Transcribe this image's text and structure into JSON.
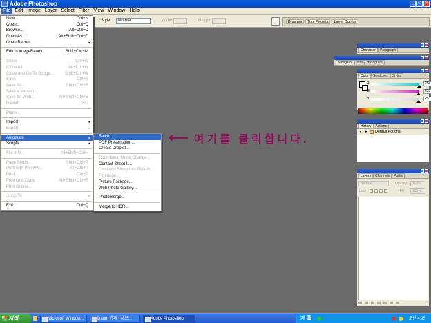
{
  "window": {
    "title": "Adobe Photoshop"
  },
  "menubar": [
    "File",
    "Edit",
    "Image",
    "Layer",
    "Select",
    "Filter",
    "View",
    "Window",
    "Help"
  ],
  "options_bar": {
    "style_label": "Style:",
    "style_value": "Normal",
    "width_label": "Width:",
    "height_label": "Height:"
  },
  "palette_well": [
    "Brushes",
    "Tool Presets",
    "Layer Comps"
  ],
  "file_menu": [
    {
      "label": "New...",
      "shortcut": "Ctrl+N",
      "enabled": true
    },
    {
      "label": "Open...",
      "shortcut": "Ctrl+O",
      "enabled": true
    },
    {
      "label": "Browse...",
      "shortcut": "Alt+Ctrl+O",
      "enabled": true
    },
    {
      "label": "Open As...",
      "shortcut": "Alt+Shift+Ctrl+O",
      "enabled": true
    },
    {
      "label": "Open Recent",
      "shortcut": "",
      "enabled": true,
      "submenu": true
    },
    {
      "separator": true
    },
    {
      "label": "Edit in ImageReady",
      "shortcut": "Shift+Ctrl+M",
      "enabled": true
    },
    {
      "separator": true
    },
    {
      "label": "Close",
      "shortcut": "Ctrl+W",
      "enabled": false
    },
    {
      "label": "Close All",
      "shortcut": "Alt+Ctrl+W",
      "enabled": false
    },
    {
      "label": "Close and Go To Bridge...",
      "shortcut": "Shift+Ctrl+W",
      "enabled": false
    },
    {
      "label": "Save",
      "shortcut": "Ctrl+S",
      "enabled": false
    },
    {
      "label": "Save As...",
      "shortcut": "Shift+Ctrl+S",
      "enabled": false
    },
    {
      "label": "Save a Version...",
      "shortcut": "",
      "enabled": false
    },
    {
      "label": "Save for Web...",
      "shortcut": "Alt+Shift+Ctrl+S",
      "enabled": false
    },
    {
      "label": "Revert",
      "shortcut": "F12",
      "enabled": false
    },
    {
      "separator": true
    },
    {
      "label": "Place...",
      "shortcut": "",
      "enabled": false
    },
    {
      "separator": true
    },
    {
      "label": "Import",
      "shortcut": "",
      "enabled": true,
      "submenu": true
    },
    {
      "label": "Export",
      "shortcut": "",
      "enabled": false,
      "submenu": true
    },
    {
      "separator": true
    },
    {
      "label": "Automate",
      "shortcut": "",
      "enabled": true,
      "submenu": true,
      "highlighted": true
    },
    {
      "label": "Scripts",
      "shortcut": "",
      "enabled": true,
      "submenu": true
    },
    {
      "separator": true
    },
    {
      "label": "File Info...",
      "shortcut": "Alt+Shift+Ctrl+I",
      "enabled": false
    },
    {
      "separator": true
    },
    {
      "label": "Page Setup...",
      "shortcut": "Shift+Ctrl+P",
      "enabled": false
    },
    {
      "label": "Print with Preview...",
      "shortcut": "Alt+Ctrl+P",
      "enabled": false
    },
    {
      "label": "Print...",
      "shortcut": "Ctrl+P",
      "enabled": false
    },
    {
      "label": "Print One Copy",
      "shortcut": "Alt+Shift+Ctrl+P",
      "enabled": false
    },
    {
      "label": "Print Online...",
      "shortcut": "",
      "enabled": false
    },
    {
      "separator": true
    },
    {
      "label": "Jump To",
      "shortcut": "",
      "enabled": false,
      "submenu": true
    },
    {
      "separator": true
    },
    {
      "label": "Exit",
      "shortcut": "Ctrl+Q",
      "enabled": true
    }
  ],
  "automate_menu": [
    {
      "label": "Batch...",
      "enabled": true,
      "highlighted": true
    },
    {
      "label": "PDF Presentation...",
      "enabled": true
    },
    {
      "label": "Create Droplet...",
      "enabled": true
    },
    {
      "separator": true
    },
    {
      "label": "Conditional Mode Change...",
      "enabled": false
    },
    {
      "label": "Contact Sheet II...",
      "enabled": true
    },
    {
      "label": "Crop and Straighten Photos",
      "enabled": false
    },
    {
      "label": "Fit Image...",
      "enabled": false
    },
    {
      "label": "Picture Package...",
      "enabled": true
    },
    {
      "label": "Web Photo Gallery...",
      "enabled": true
    },
    {
      "separator": true
    },
    {
      "label": "Photomerge...",
      "enabled": true
    },
    {
      "separator": true
    },
    {
      "label": "Merge to HDR...",
      "enabled": true
    }
  ],
  "annotation": {
    "text": "여기를 클릭합니다.",
    "color": "#8e0e5c"
  },
  "palettes": {
    "character": {
      "tabs": [
        "Character",
        "Paragraph"
      ]
    },
    "navigator": {
      "tabs": [
        "Navigator",
        "Info",
        "Histogram"
      ]
    },
    "color": {
      "tabs": [
        "Color",
        "Swatches",
        "Styles"
      ],
      "channels": [
        {
          "label": "R",
          "value": "254",
          "color": "#20c8c8",
          "level": 0.996
        },
        {
          "label": "G",
          "value": "253",
          "color": "#d020c0",
          "level": 0.992
        },
        {
          "label": "B",
          "value": "253",
          "color": "#d8d8d8",
          "level": 0.992
        }
      ]
    },
    "history": {
      "tabs": [
        "History",
        "Actions"
      ],
      "set_name": "Default Actions"
    },
    "layers": {
      "tabs": [
        "Layers",
        "Channels",
        "Paths"
      ],
      "blend_mode": "Normal",
      "opacity_label": "Opacity:",
      "opacity_value": "100%",
      "lock_label": "Lock:",
      "fill_label": "Fill:",
      "fill_value": "100%"
    }
  },
  "taskbar": {
    "start_label": "시작",
    "buttons": [
      {
        "label": "Microsoft Window...",
        "active": false
      },
      {
        "label": "Daum 카페 | 사브...",
        "active": false
      },
      {
        "label": "Adobe Photoshop",
        "active": true
      }
    ],
    "ime": "가 漢",
    "clock": "오전 4:15"
  }
}
